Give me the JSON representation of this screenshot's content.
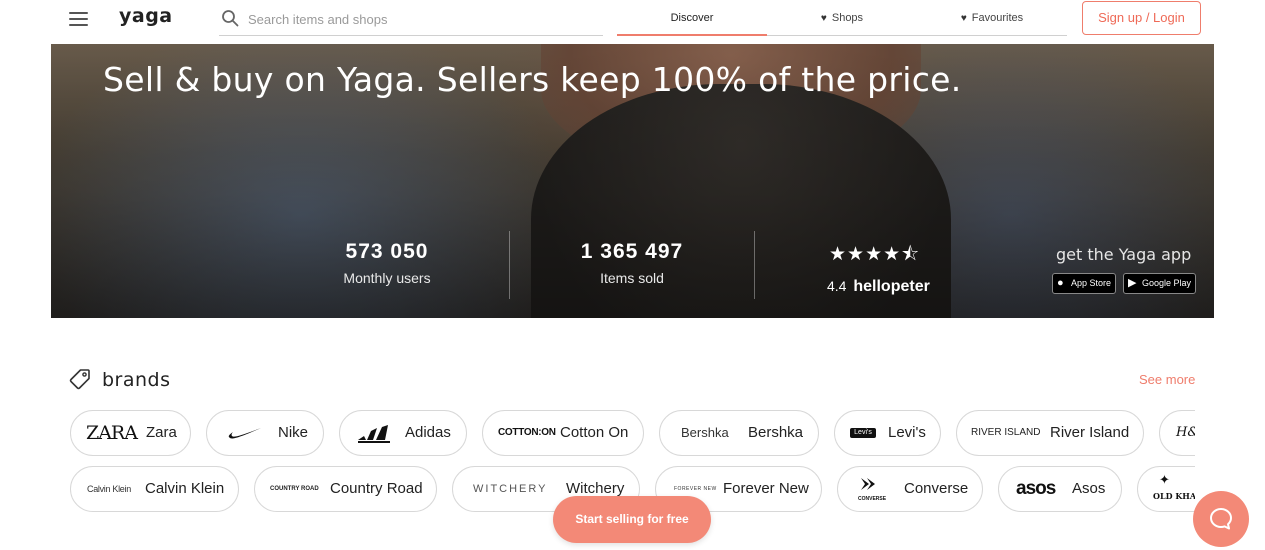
{
  "header": {
    "logo": "yaga",
    "search_placeholder": "Search items and shops",
    "tabs": [
      {
        "label": "Discover",
        "active": true,
        "icon": ""
      },
      {
        "label": "Shops",
        "active": false,
        "icon": "heart-icon"
      },
      {
        "label": "Favourites",
        "active": false,
        "icon": "heart-icon"
      }
    ],
    "signup_label": "Sign up / Login"
  },
  "hero": {
    "title": "Sell & buy on Yaga. Sellers keep 100% of the price.",
    "stats": [
      {
        "value": "573 050",
        "label": "Monthly users"
      },
      {
        "value": "1 365 497",
        "label": "Items sold"
      }
    ],
    "rating": {
      "stars": "★★★★⯪",
      "score": "4.4",
      "brand": "hellopeter",
      "value": 4.4
    },
    "app_label": "get the Yaga app",
    "app_store": "App Store",
    "google_play": "Google Play"
  },
  "brands": {
    "title": "brands",
    "see_more": "See more",
    "row1": [
      {
        "logo": "ZARA",
        "name": "Zara"
      },
      {
        "logo": "✔",
        "name": "Nike"
      },
      {
        "logo": "⩙",
        "name": "Adidas"
      },
      {
        "logo": "COTTON:ON",
        "name": "Cotton On"
      },
      {
        "logo": "Bershka",
        "name": "Bershka"
      },
      {
        "logo": "Levi's",
        "name": "Levi's"
      },
      {
        "logo": "RIVER ISLAND",
        "name": "River Island"
      },
      {
        "logo": "H&M",
        "name": ""
      }
    ],
    "row2": [
      {
        "logo": "Calvin Klein",
        "name": "Calvin Klein"
      },
      {
        "logo": "COUNTRY ROAD",
        "name": "Country Road"
      },
      {
        "logo": "WITCHERY",
        "name": "Witchery"
      },
      {
        "logo": "FOREVER NEW",
        "name": "Forever New"
      },
      {
        "logo": "CONVERSE",
        "name": "Converse"
      },
      {
        "logo": "asos",
        "name": "Asos"
      },
      {
        "logo": "OLD KHAKI",
        "name": ""
      }
    ]
  },
  "sell_button": "Start selling for free",
  "colors": {
    "accent": "#ef7d6c",
    "button": "#f38977"
  }
}
